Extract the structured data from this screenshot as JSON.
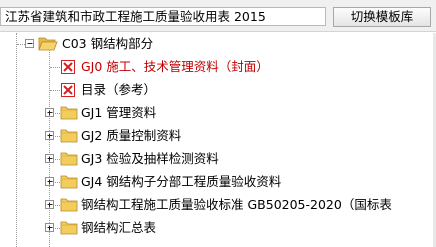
{
  "header": {
    "title": "江苏省建筑和市政工程施工质量验收用表 2015",
    "switch_button": "切换模板库"
  },
  "tree": {
    "parent": {
      "label": "C03 钢结构部分",
      "expanded": true,
      "icon": "folder-open-icon"
    },
    "items": [
      {
        "label": "GJ0 施工、技术管理资料（封面）",
        "icon": "error-doc-icon",
        "color": "#c00000"
      },
      {
        "label": "目录（参考）",
        "icon": "error-doc-icon",
        "color": "#c00000"
      },
      {
        "label": "GJ1 管理资料",
        "icon": "folder-icon"
      },
      {
        "label": "GJ2 质量控制资料",
        "icon": "folder-icon"
      },
      {
        "label": "GJ3 检验及抽样检测资料",
        "icon": "folder-icon"
      },
      {
        "label": "GJ4 钢结构子分部工程质量验收资料",
        "icon": "folder-icon"
      },
      {
        "label": "钢结构工程施工质量验收标准 GB50205-2020（国标表",
        "icon": "folder-icon"
      },
      {
        "label": "钢结构汇总表",
        "icon": "folder-icon"
      }
    ]
  },
  "colors": {
    "folder": "#f2cd5c",
    "error": "#d81f1f",
    "selected_text": "#c00000"
  }
}
